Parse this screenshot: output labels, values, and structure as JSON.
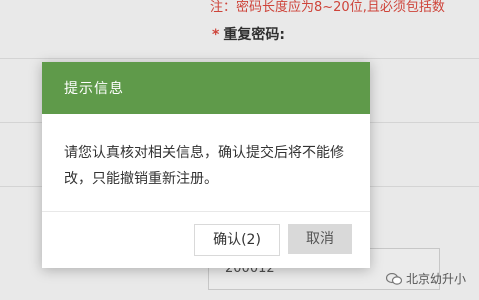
{
  "background": {
    "hint": "注：密码长度应为8~20位,且必须包括数",
    "required_mark": "*",
    "repeat_password_label": "重复密码:",
    "field_value": "200012"
  },
  "dialog": {
    "title": "提示信息",
    "message": "请您认真核对相关信息，确认提交后将不能修改，只能撤销重新注册。",
    "confirm_label": "确认(2)",
    "cancel_label": "取消"
  },
  "watermark": {
    "text": "北京幼升小"
  },
  "colors": {
    "header_green": "#5f9a4a",
    "hint_red": "#e04a3f"
  }
}
